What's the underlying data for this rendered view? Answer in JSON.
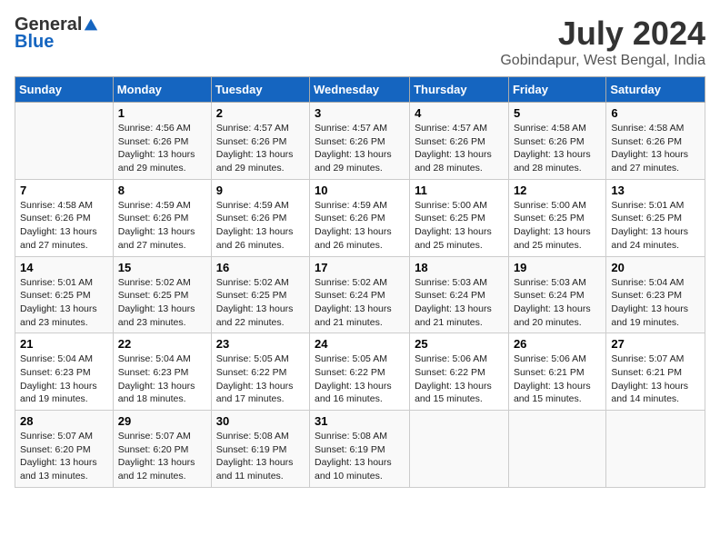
{
  "logo": {
    "general": "General",
    "blue": "Blue"
  },
  "title": "July 2024",
  "subtitle": "Gobindapur, West Bengal, India",
  "days_of_week": [
    "Sunday",
    "Monday",
    "Tuesday",
    "Wednesday",
    "Thursday",
    "Friday",
    "Saturday"
  ],
  "weeks": [
    [
      {
        "num": "",
        "text": ""
      },
      {
        "num": "1",
        "text": "Sunrise: 4:56 AM\nSunset: 6:26 PM\nDaylight: 13 hours and 29 minutes."
      },
      {
        "num": "2",
        "text": "Sunrise: 4:57 AM\nSunset: 6:26 PM\nDaylight: 13 hours and 29 minutes."
      },
      {
        "num": "3",
        "text": "Sunrise: 4:57 AM\nSunset: 6:26 PM\nDaylight: 13 hours and 29 minutes."
      },
      {
        "num": "4",
        "text": "Sunrise: 4:57 AM\nSunset: 6:26 PM\nDaylight: 13 hours and 28 minutes."
      },
      {
        "num": "5",
        "text": "Sunrise: 4:58 AM\nSunset: 6:26 PM\nDaylight: 13 hours and 28 minutes."
      },
      {
        "num": "6",
        "text": "Sunrise: 4:58 AM\nSunset: 6:26 PM\nDaylight: 13 hours and 27 minutes."
      }
    ],
    [
      {
        "num": "7",
        "text": "Sunrise: 4:58 AM\nSunset: 6:26 PM\nDaylight: 13 hours and 27 minutes."
      },
      {
        "num": "8",
        "text": "Sunrise: 4:59 AM\nSunset: 6:26 PM\nDaylight: 13 hours and 27 minutes."
      },
      {
        "num": "9",
        "text": "Sunrise: 4:59 AM\nSunset: 6:26 PM\nDaylight: 13 hours and 26 minutes."
      },
      {
        "num": "10",
        "text": "Sunrise: 4:59 AM\nSunset: 6:26 PM\nDaylight: 13 hours and 26 minutes."
      },
      {
        "num": "11",
        "text": "Sunrise: 5:00 AM\nSunset: 6:25 PM\nDaylight: 13 hours and 25 minutes."
      },
      {
        "num": "12",
        "text": "Sunrise: 5:00 AM\nSunset: 6:25 PM\nDaylight: 13 hours and 25 minutes."
      },
      {
        "num": "13",
        "text": "Sunrise: 5:01 AM\nSunset: 6:25 PM\nDaylight: 13 hours and 24 minutes."
      }
    ],
    [
      {
        "num": "14",
        "text": "Sunrise: 5:01 AM\nSunset: 6:25 PM\nDaylight: 13 hours and 23 minutes."
      },
      {
        "num": "15",
        "text": "Sunrise: 5:02 AM\nSunset: 6:25 PM\nDaylight: 13 hours and 23 minutes."
      },
      {
        "num": "16",
        "text": "Sunrise: 5:02 AM\nSunset: 6:25 PM\nDaylight: 13 hours and 22 minutes."
      },
      {
        "num": "17",
        "text": "Sunrise: 5:02 AM\nSunset: 6:24 PM\nDaylight: 13 hours and 21 minutes."
      },
      {
        "num": "18",
        "text": "Sunrise: 5:03 AM\nSunset: 6:24 PM\nDaylight: 13 hours and 21 minutes."
      },
      {
        "num": "19",
        "text": "Sunrise: 5:03 AM\nSunset: 6:24 PM\nDaylight: 13 hours and 20 minutes."
      },
      {
        "num": "20",
        "text": "Sunrise: 5:04 AM\nSunset: 6:23 PM\nDaylight: 13 hours and 19 minutes."
      }
    ],
    [
      {
        "num": "21",
        "text": "Sunrise: 5:04 AM\nSunset: 6:23 PM\nDaylight: 13 hours and 19 minutes."
      },
      {
        "num": "22",
        "text": "Sunrise: 5:04 AM\nSunset: 6:23 PM\nDaylight: 13 hours and 18 minutes."
      },
      {
        "num": "23",
        "text": "Sunrise: 5:05 AM\nSunset: 6:22 PM\nDaylight: 13 hours and 17 minutes."
      },
      {
        "num": "24",
        "text": "Sunrise: 5:05 AM\nSunset: 6:22 PM\nDaylight: 13 hours and 16 minutes."
      },
      {
        "num": "25",
        "text": "Sunrise: 5:06 AM\nSunset: 6:22 PM\nDaylight: 13 hours and 15 minutes."
      },
      {
        "num": "26",
        "text": "Sunrise: 5:06 AM\nSunset: 6:21 PM\nDaylight: 13 hours and 15 minutes."
      },
      {
        "num": "27",
        "text": "Sunrise: 5:07 AM\nSunset: 6:21 PM\nDaylight: 13 hours and 14 minutes."
      }
    ],
    [
      {
        "num": "28",
        "text": "Sunrise: 5:07 AM\nSunset: 6:20 PM\nDaylight: 13 hours and 13 minutes."
      },
      {
        "num": "29",
        "text": "Sunrise: 5:07 AM\nSunset: 6:20 PM\nDaylight: 13 hours and 12 minutes."
      },
      {
        "num": "30",
        "text": "Sunrise: 5:08 AM\nSunset: 6:19 PM\nDaylight: 13 hours and 11 minutes."
      },
      {
        "num": "31",
        "text": "Sunrise: 5:08 AM\nSunset: 6:19 PM\nDaylight: 13 hours and 10 minutes."
      },
      {
        "num": "",
        "text": ""
      },
      {
        "num": "",
        "text": ""
      },
      {
        "num": "",
        "text": ""
      }
    ]
  ]
}
